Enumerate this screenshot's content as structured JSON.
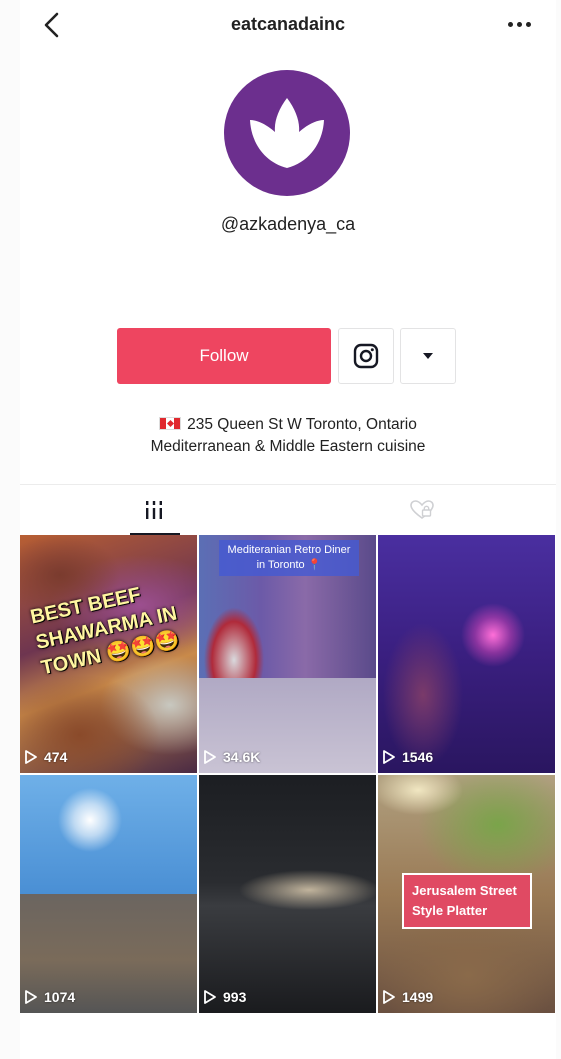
{
  "header": {
    "title": "eatcanadainc",
    "back_icon": "back-chevron-icon",
    "more_icon": "more-horizontal-icon"
  },
  "profile": {
    "handle": "@azkadenya_ca",
    "avatar_color": "#6c2f8e",
    "avatar_icon": "lotus-logo"
  },
  "actions": {
    "follow_label": "Follow",
    "follow_color": "#ee4560",
    "instagram_icon": "instagram-icon",
    "dropdown_icon": "caret-down-icon"
  },
  "bio": {
    "flag_icon": "canada-flag-icon",
    "line1": "235 Queen St W Toronto, Ontario",
    "line2": "Mediterranean & Middle Eastern cuisine"
  },
  "tabs": {
    "videos_icon": "grid-icon",
    "liked_icon": "heart-locked-icon"
  },
  "videos": [
    {
      "views": "474",
      "caption": "BEST BEEF SHAWARMA IN TOWN 🤩🤩🤩"
    },
    {
      "views": "34.6K",
      "caption": "Mediteranian Retro Diner in Toronto 📍"
    },
    {
      "views": "1546",
      "caption": ""
    },
    {
      "views": "1074",
      "caption": ""
    },
    {
      "views": "993",
      "caption": ""
    },
    {
      "views": "1499",
      "caption": "Jerusalem Street Style Platter"
    }
  ]
}
